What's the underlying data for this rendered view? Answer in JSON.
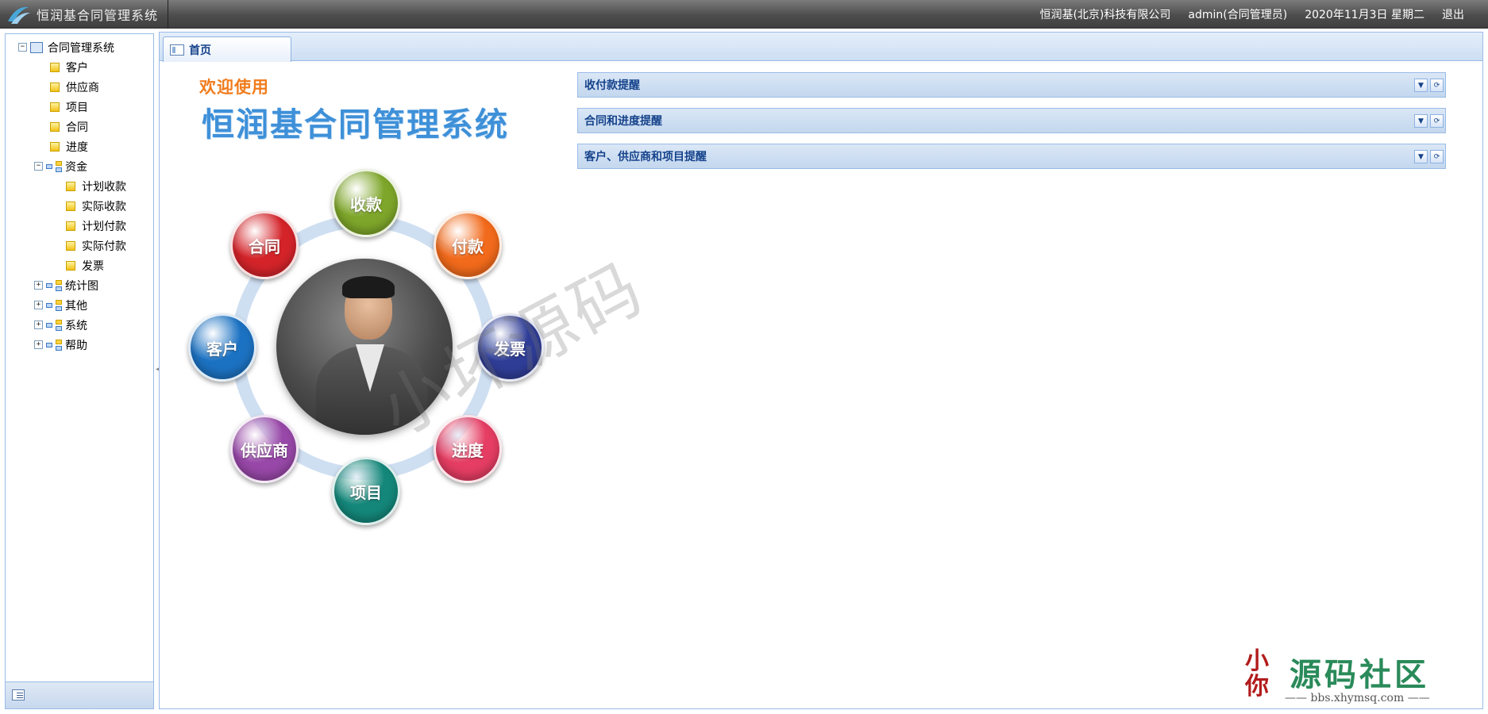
{
  "app": {
    "title": "恒润基合同管理系统",
    "company": "恒润基(北京)科技有限公司",
    "user": "admin(合同管理员)",
    "date": "2020年11月3日 星期二",
    "logout": "退出"
  },
  "sidebar": {
    "root": "合同管理系统",
    "items": [
      "客户",
      "供应商",
      "项目",
      "合同",
      "进度"
    ],
    "fund": {
      "label": "资金",
      "children": [
        "计划收款",
        "实际收款",
        "计划付款",
        "实际付款",
        "发票"
      ]
    },
    "groups": [
      "统计图",
      "其他",
      "系统",
      "帮助"
    ]
  },
  "tabs": [
    {
      "label": "首页"
    }
  ],
  "welcome": {
    "line1": "欢迎使用",
    "line2": "恒润基合同管理系统"
  },
  "bubbles": {
    "shoukuan": "收款",
    "fukuan": "付款",
    "fapiao": "发票",
    "jindu": "进度",
    "xiangmu": "项目",
    "gongyingshang": "供应商",
    "kehu": "客户",
    "hetong": "合同"
  },
  "bubble_colors": {
    "shoukuan": "#7ea62a",
    "fukuan": "#f26a1b",
    "fapiao": "#2f3d96",
    "jindu": "#e53d63",
    "xiangmu": "#14877a",
    "gongyingshang": "#9848a8",
    "kehu": "#1c72c2",
    "hetong": "#d4242a"
  },
  "watermark": "小坏源码",
  "panels": [
    {
      "title": "收付款提醒"
    },
    {
      "title": "合同和进度提醒"
    },
    {
      "title": "客户、供应商和项目提醒"
    }
  ],
  "community": {
    "seal": "小\n你",
    "name": "源码社区",
    "url": "—— bbs.xhymsq.com ——"
  }
}
